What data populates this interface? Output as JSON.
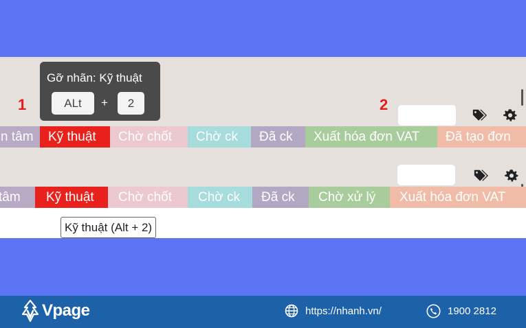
{
  "annotations": {
    "marker_1": "1",
    "marker_2": "2"
  },
  "shortcut_tooltip": {
    "title": "Gỡ nhãn: Kỹ thuật",
    "key_modifier": "ALt",
    "plus": "+",
    "key_number": "2"
  },
  "label_tooltip": {
    "text": "Kỹ thuật (Alt + 2)"
  },
  "toolbar_1": {
    "tags": [
      {
        "label": "n tâm",
        "color": "#b8a9c4"
      },
      {
        "label": "Kỹ thuật",
        "color": "#e8211c"
      },
      {
        "label": "Chờ chốt",
        "color": "#ecc8d0"
      },
      {
        "label": "Chờ ck",
        "color": "#a6dcdc"
      },
      {
        "label": "Đã ck",
        "color": "#b2a8c4"
      },
      {
        "label": "Xuất hóa đơn VAT",
        "color": "#a8cc9c"
      },
      {
        "label": "Đã tạo đơn",
        "color": "#f0bca8"
      }
    ]
  },
  "toolbar_2": {
    "tags": [
      {
        "label": "tâm",
        "color": "#b8a9c4"
      },
      {
        "label": "Kỹ thuật",
        "color": "#e8211c"
      },
      {
        "label": "Chờ chốt",
        "color": "#ecc8d0"
      },
      {
        "label": "Chờ ck",
        "color": "#a6dcdc"
      },
      {
        "label": "Đã ck",
        "color": "#b2a8c4"
      },
      {
        "label": "Chờ xử lý",
        "color": "#a8cc9c"
      },
      {
        "label": "Xuất hóa đơn VAT",
        "color": "#f0bca8"
      }
    ]
  },
  "icons": {
    "tag": "tags-icon",
    "settings": "gear-icon"
  },
  "footer": {
    "brand": "Vpage",
    "website": "https://nhanh.vn/",
    "phone": "1900 2812",
    "background": "#1d62a8"
  }
}
